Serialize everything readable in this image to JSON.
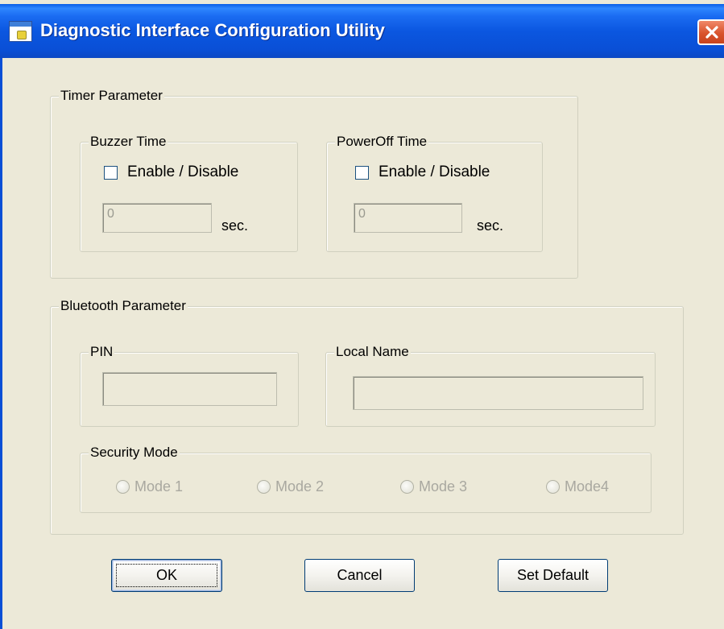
{
  "window": {
    "title": "Diagnostic Interface Configuration Utility",
    "icon": "app-window-icon",
    "close_icon": "close-icon"
  },
  "timer": {
    "legend": "Timer Parameter",
    "buzzer": {
      "legend": "Buzzer Time",
      "checkbox_label": "Enable / Disable",
      "checked": false,
      "value": "0",
      "unit": "sec."
    },
    "poweroff": {
      "legend": "PowerOff Time",
      "checkbox_label": "Enable / Disable",
      "checked": false,
      "value": "0",
      "unit": "sec."
    }
  },
  "bluetooth": {
    "legend": "Bluetooth Parameter",
    "pin": {
      "legend": "PIN",
      "value": ""
    },
    "local_name": {
      "legend": "Local Name",
      "value": ""
    },
    "security": {
      "legend": "Security Mode",
      "modes": [
        "Mode 1",
        "Mode 2",
        "Mode 3",
        "Mode4"
      ],
      "enabled": false
    }
  },
  "buttons": {
    "ok": "OK",
    "cancel": "Cancel",
    "set_default": "Set Default"
  },
  "colors": {
    "title_bar": "#0a4fd6",
    "dialog_bg": "#ece9d8",
    "close_button": "#d9532d",
    "disabled_text": "#a9a8a0"
  }
}
